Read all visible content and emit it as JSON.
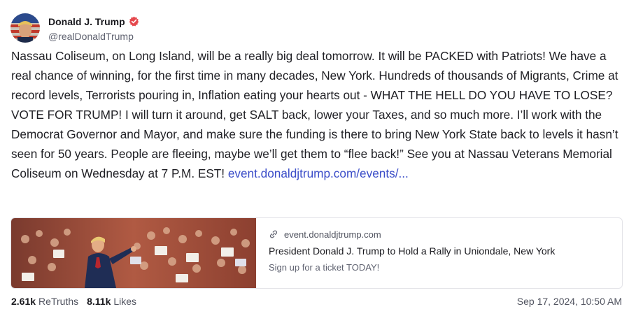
{
  "author": {
    "display_name": "Donald J. Trump",
    "handle": "@realDonaldTrump",
    "verified": true
  },
  "post": {
    "text": "Nassau Coliseum, on Long Island, will be a really big deal tomorrow. It will be PACKED with Patriots! We have a real chance of winning, for the first time in many decades, New York. Hundreds of thousands of Migrants, Crime at record levels, Terrorists pouring in, Inflation eating your hearts out - WHAT THE HELL DO YOU HAVE TO LOSE? VOTE FOR TRUMP! I will turn it around, get SALT back, lower your Taxes, and so much more. I’ll work with the Democrat Governor and Mayor, and make sure the funding is there to bring New York State back to levels it hasn’t seen for 50 years. People are fleeing, maybe we’ll get them to “flee back!” See you at Nassau Veterans Memorial Coliseum on Wednesday at 7 P.M. EST! ",
    "link_text": "event.donaldjtrump.com/events/..."
  },
  "link_card": {
    "domain": "event.donaldjtrump.com",
    "title": "President Donald J. Trump to Hold a Rally in Uniondale, New York",
    "description": "Sign up for a ticket TODAY!"
  },
  "stats": {
    "retruths_count": "2.61k",
    "retruths_label": "ReTruths",
    "likes_count": "8.11k",
    "likes_label": "Likes"
  },
  "timestamp": "Sep 17, 2024, 10:50 AM",
  "colors": {
    "link": "#3b4dc8",
    "verified_badge": "#e5484d",
    "muted_text": "#5f6270"
  },
  "icons": [
    "verified-badge-icon",
    "link-icon"
  ]
}
